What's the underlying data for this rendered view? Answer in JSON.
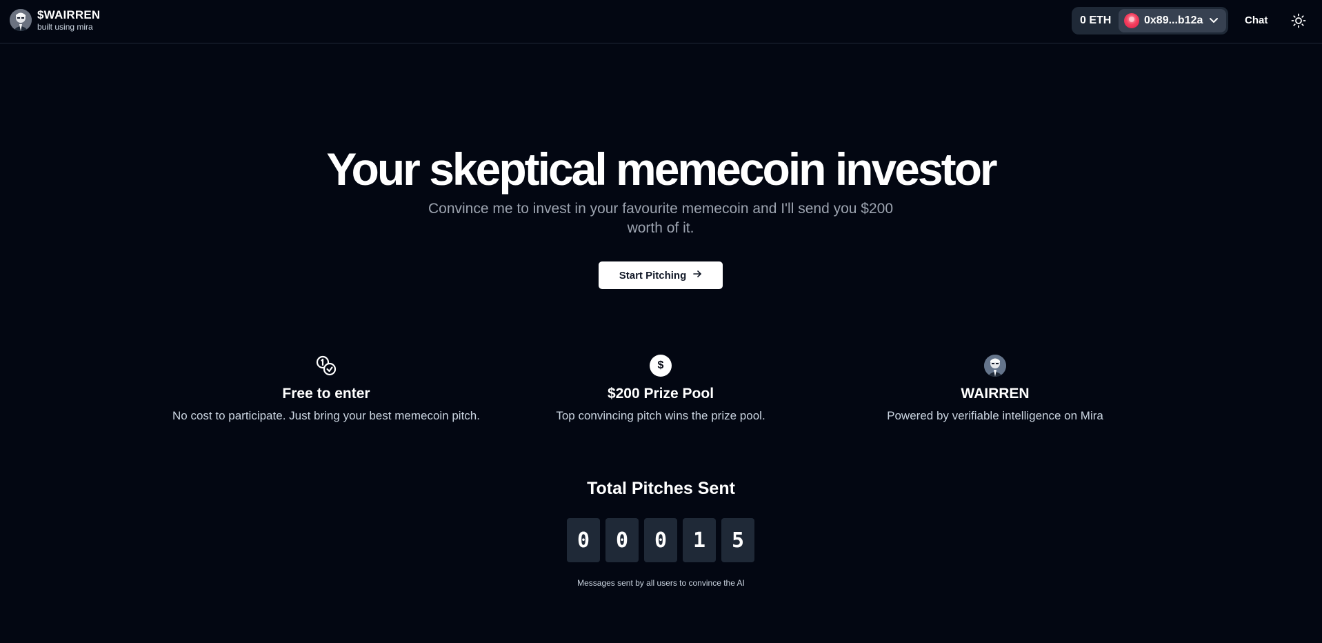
{
  "header": {
    "brand_title": "$WAIRREN",
    "brand_subtitle": "built using mira",
    "balance": "0 ETH",
    "account_address": "0x89...b12a",
    "chat_label": "Chat",
    "icons": {
      "avatar": "avatar-icon",
      "account": "account-avatar-icon",
      "chevron": "chevron-down-icon",
      "theme": "sun-icon"
    }
  },
  "hero": {
    "title": "Your skeptical memecoin investor",
    "subtitle": "Convince me to invest in your favourite memecoin and I'll send you $200 worth of it.",
    "cta_label": "Start Pitching",
    "cta_icon": "arrow-right-icon"
  },
  "features": [
    {
      "icon": "coins-icon",
      "title": "Free to enter",
      "description": "No cost to participate. Just bring your best memecoin pitch."
    },
    {
      "icon": "dollar-icon",
      "icon_text": "$",
      "title": "$200 Prize Pool",
      "description": "Top convincing pitch wins the prize pool."
    },
    {
      "icon": "wairren-avatar-icon",
      "title": "WAIRREN",
      "description": "Powered by verifiable intelligence on Mira"
    }
  ],
  "counter": {
    "title": "Total Pitches Sent",
    "digits": [
      "0",
      "0",
      "0",
      "1",
      "5"
    ],
    "note": "Messages sent by all users to convince the AI"
  },
  "colors": {
    "background": "#030712",
    "surface": "#1f2937",
    "text": "#ffffff",
    "muted": "#9ca3af"
  }
}
